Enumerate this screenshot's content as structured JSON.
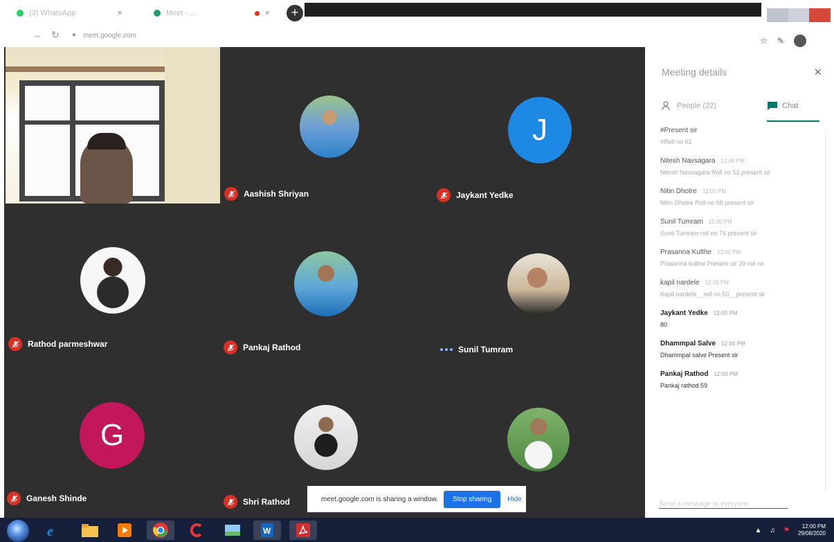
{
  "browser": {
    "tabs": [
      {
        "label": "(3) WhatsApp",
        "icon": "whatsapp-icon",
        "color": "#25d366"
      },
      {
        "label": "Meet - ...",
        "icon": "meet-icon",
        "color": "#20a070"
      }
    ],
    "close_glyph": "×",
    "new_tab_glyph": "+",
    "url": "meet.google.com"
  },
  "meeting": {
    "participants": [
      {
        "name": "Aashish Shriyan",
        "type": "photo",
        "muted": true
      },
      {
        "name": "Jaykant Yedke",
        "type": "letter",
        "letter": "J",
        "color": "#1e88e5",
        "muted": true
      },
      {
        "name": "Rathod parmeshwar",
        "type": "photo",
        "muted": true
      },
      {
        "name": "Pankaj Rathod",
        "type": "photo",
        "muted": true
      },
      {
        "name": "Sunil Tumram",
        "type": "photo",
        "muted": false
      },
      {
        "name": "Ganesh Shinde",
        "type": "letter",
        "letter": "G",
        "color": "#c2185b",
        "muted": true
      },
      {
        "name": "Shri Rathod",
        "type": "photo",
        "muted": true
      }
    ]
  },
  "panel": {
    "title": "Meeting details",
    "close_glyph": "×",
    "people_tab": "People (22)",
    "chat_tab": "Chat",
    "messages": [
      {
        "sender": "#Present sir",
        "time": "",
        "text": "#Roll no 61",
        "bold": false
      },
      {
        "sender": "Nitesh Navsagara",
        "time": "12:00 PM",
        "text": "Nitesh Navsagara Roll no 52 present sir",
        "bold": false
      },
      {
        "sender": "Nitin Dhotre",
        "time": "12:00 PM",
        "text": "Nitin Dhotre Roll no 08 present sir",
        "bold": false
      },
      {
        "sender": "Sunil Tumram",
        "time": "12:00 PM",
        "text": "Sunil Tumram roll no 76 present sir",
        "bold": false
      },
      {
        "sender": "Prasanna Kulthe",
        "time": "12:00 PM",
        "text": "Prasanna kulthe Present sir 39 roll no",
        "bold": false
      },
      {
        "sender": "kapil nardele",
        "time": "12:00 PM",
        "text": "Kapil nardele__roll no 50__present sir",
        "bold": false
      },
      {
        "sender": "Jaykant Yedke",
        "time": "12:00 PM",
        "text": "80",
        "bold": true
      },
      {
        "sender": "Dhammpal Salve",
        "time": "12:00 PM",
        "text": "Dhammpal salve Present sir",
        "bold": true
      },
      {
        "sender": "Pankaj Rathod",
        "time": "12:00 PM",
        "text": "Pankaj rathod 59",
        "bold": true
      }
    ],
    "send_placeholder": "Send a message to everyone"
  },
  "share_popup": {
    "message": "meet.google.com is sharing a window.",
    "stop_label": "Stop sharing",
    "hide_label": "Hide"
  },
  "taskbar": {
    "apps": [
      {
        "icon": "ie-icon",
        "color": "#1e88e5"
      },
      {
        "icon": "folder-icon",
        "color": "#f2c14e"
      },
      {
        "icon": "media-player-icon",
        "color": "#f57c00"
      },
      {
        "icon": "chrome-icon",
        "color": "#4caf50"
      },
      {
        "icon": "ccleaner-icon",
        "color": "#e53935"
      },
      {
        "icon": "paint-icon",
        "color": "#90caf9"
      },
      {
        "icon": "word-icon",
        "color": "#1565c0"
      },
      {
        "icon": "acrobat-icon",
        "color": "#d32f2f"
      }
    ],
    "time": "12:00 PM",
    "date": "29/08/2020"
  }
}
